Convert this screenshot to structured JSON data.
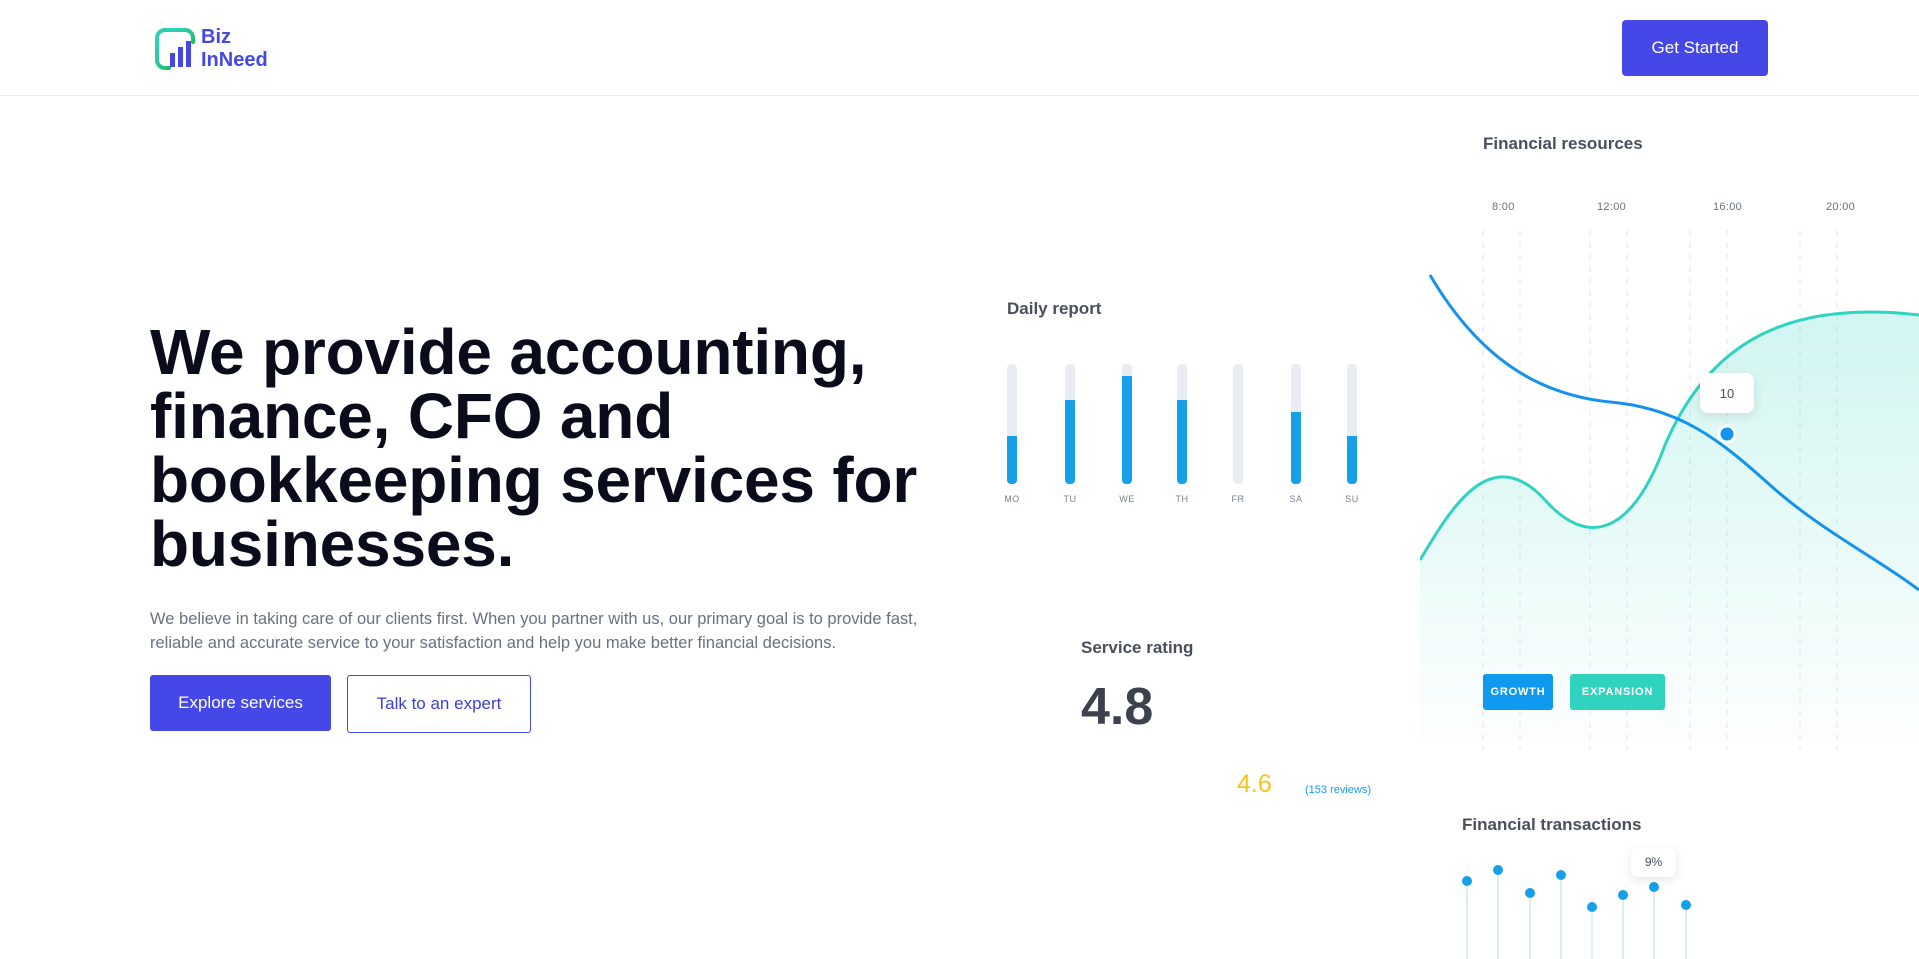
{
  "header": {
    "logo_line1": "Biz",
    "logo_line2": "InNeed",
    "cta_label": "Get Started"
  },
  "hero": {
    "title": "We provide accounting, finance, CFO and bookkeeping services for businesses.",
    "subtitle": "We believe in taking care of our clients first. When you partner with us, our primary goal is to provide fast, reliable and accurate service to your satisfaction and help you make better financial decisions.",
    "primary_button": "Explore services",
    "secondary_button": "Talk to an expert"
  },
  "daily_report": {
    "title": "Daily report",
    "days": [
      "MO",
      "TU",
      "WE",
      "TH",
      "FR",
      "SA",
      "SU"
    ],
    "levels": [
      0.4,
      0.7,
      0.9,
      0.7,
      0.0,
      0.6,
      0.4
    ]
  },
  "service_rating": {
    "title": "Service rating",
    "value": "4.8",
    "secondary_value": "4.6",
    "reviews": "(153 reviews)"
  },
  "financial_resources": {
    "title": "Financial resources",
    "times": [
      "8:00",
      "12:00",
      "16:00",
      "20:00"
    ],
    "tooltip": "10",
    "tags": [
      "GROWTH",
      "EXPANSION"
    ]
  },
  "financial_transactions": {
    "title": "Financial transactions",
    "tooltip": "9%"
  },
  "colors": {
    "accent": "#4548e6",
    "bar_blue": "#15a0e8",
    "teal": "#2fd3c0",
    "star_yellow": "#f5c518"
  }
}
